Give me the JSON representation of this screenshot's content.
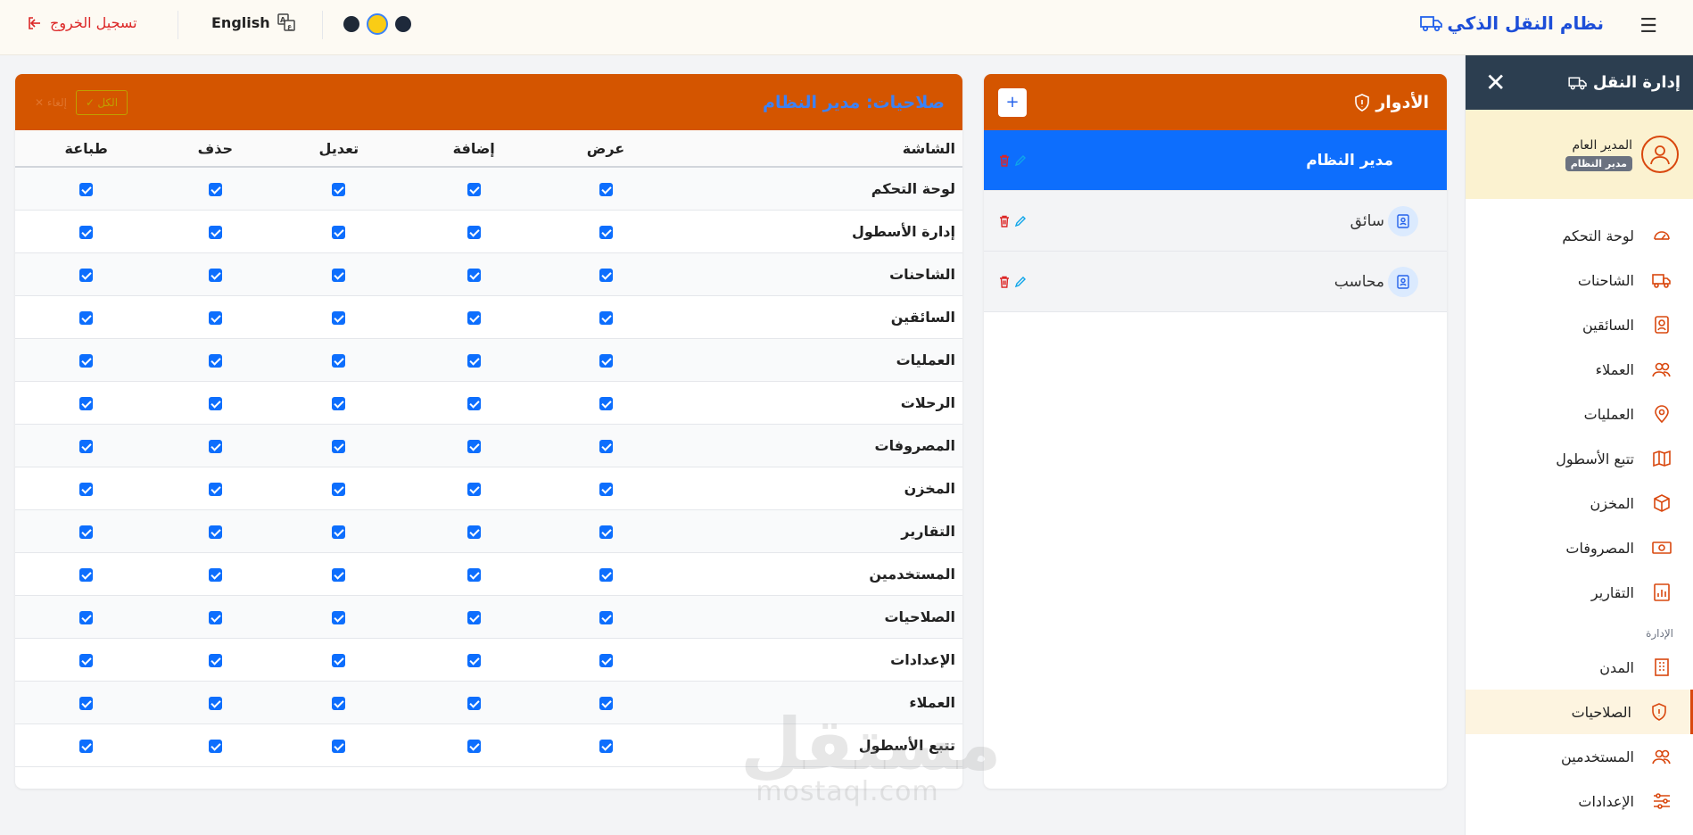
{
  "topbar": {
    "app_title": "نظام النقل الذكي",
    "language_label": "English",
    "logout_label": "تسجيل الخروج",
    "theme_dots": [
      "#1f2937",
      "#facc15",
      "#1e293b"
    ]
  },
  "sidebar": {
    "title": "إدارة النقل",
    "user_name": "المدير العام",
    "user_role": "مدير النظام",
    "items": [
      {
        "label": "لوحة التحكم",
        "icon": "dashboard-icon"
      },
      {
        "label": "الشاحنات",
        "icon": "truck-icon"
      },
      {
        "label": "السائقين",
        "icon": "driver-icon"
      },
      {
        "label": "العملاء",
        "icon": "users-icon"
      },
      {
        "label": "العمليات",
        "icon": "location-icon"
      },
      {
        "label": "تتبع الأسطول",
        "icon": "map-icon"
      },
      {
        "label": "المخزن",
        "icon": "box-icon"
      },
      {
        "label": "المصروفات",
        "icon": "money-icon"
      },
      {
        "label": "التقارير",
        "icon": "chart-icon"
      }
    ],
    "section_label": "الإدارة",
    "admin_items": [
      {
        "label": "المدن",
        "icon": "building-icon"
      },
      {
        "label": "الصلاحيات",
        "icon": "shield-icon",
        "active": true
      },
      {
        "label": "المستخدمين",
        "icon": "users-icon"
      },
      {
        "label": "الإعدادات",
        "icon": "settings-icon"
      }
    ]
  },
  "roles_panel": {
    "title": "الأدوار",
    "add_label": "+",
    "roles": [
      {
        "name": "مدير النظام",
        "active": true
      },
      {
        "name": "سائق",
        "active": false
      },
      {
        "name": "محاسب",
        "active": false
      }
    ]
  },
  "permissions_panel": {
    "title": "صلاحيات: مدير النظام",
    "select_all_label": "✓ الكل",
    "select_none_label": "✕ إلغاء",
    "columns": [
      "الشاشة",
      "عرض",
      "إضافة",
      "تعديل",
      "حذف",
      "طباعة"
    ],
    "rows": [
      {
        "screen": "لوحة التحكم",
        "perms": [
          true,
          true,
          true,
          true,
          true
        ]
      },
      {
        "screen": "إدارة الأسطول",
        "perms": [
          true,
          true,
          true,
          true,
          true
        ]
      },
      {
        "screen": "الشاحنات",
        "perms": [
          true,
          true,
          true,
          true,
          true
        ]
      },
      {
        "screen": "السائقين",
        "perms": [
          true,
          true,
          true,
          true,
          true
        ]
      },
      {
        "screen": "العمليات",
        "perms": [
          true,
          true,
          true,
          true,
          true
        ]
      },
      {
        "screen": "الرحلات",
        "perms": [
          true,
          true,
          true,
          true,
          true
        ]
      },
      {
        "screen": "المصروفات",
        "perms": [
          true,
          true,
          true,
          true,
          true
        ]
      },
      {
        "screen": "المخزن",
        "perms": [
          true,
          true,
          true,
          true,
          true
        ]
      },
      {
        "screen": "التقارير",
        "perms": [
          true,
          true,
          true,
          true,
          true
        ]
      },
      {
        "screen": "المستخدمين",
        "perms": [
          true,
          true,
          true,
          true,
          true
        ]
      },
      {
        "screen": "الصلاحيات",
        "perms": [
          true,
          true,
          true,
          true,
          true
        ]
      },
      {
        "screen": "الإعدادات",
        "perms": [
          true,
          true,
          true,
          true,
          true
        ]
      },
      {
        "screen": "العملاء",
        "perms": [
          true,
          true,
          true,
          true,
          true
        ]
      },
      {
        "screen": "تتبع الأسطول",
        "perms": [
          true,
          true,
          true,
          true,
          true
        ]
      }
    ]
  },
  "watermark": {
    "big": "مستقل",
    "small": "mostaql.com"
  }
}
